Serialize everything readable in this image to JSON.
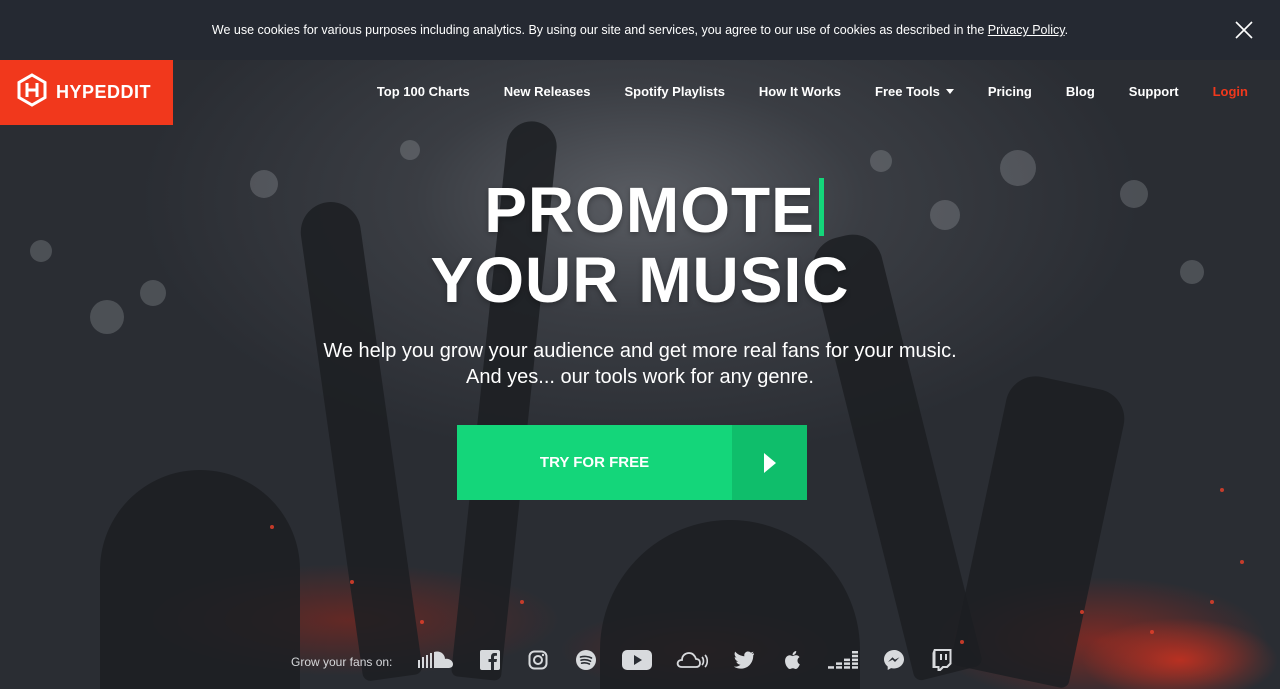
{
  "cookie_bar": {
    "text": "We use cookies for various purposes including analytics. By using our site and services, you agree to our use of cookies as described in the ",
    "link": "Privacy Policy",
    "end": ".",
    "close_icon": "close-icon"
  },
  "brand": {
    "name": "HYPEDDIT",
    "color": "#f1381c"
  },
  "nav": {
    "items": [
      "Top 100 Charts",
      "New Releases",
      "Spotify Playlists",
      "How It Works",
      "Free Tools",
      "Pricing",
      "Blog",
      "Support"
    ],
    "login": "Login"
  },
  "hero": {
    "line1": "PROMOTE",
    "line2": "YOUR MUSIC",
    "sub1": "We help you grow your audience and get more real fans for your music.",
    "sub2": "And yes... our tools work for any genre.",
    "cta": "TRY FOR FREE",
    "accent": "#14d67a"
  },
  "footer": {
    "label": "Grow your fans on:",
    "platforms": [
      "soundcloud-icon",
      "facebook-icon",
      "instagram-icon",
      "spotify-icon",
      "youtube-icon",
      "mixcloud-icon",
      "twitter-icon",
      "apple-icon",
      "deezer-icon",
      "messenger-icon",
      "twitch-icon"
    ]
  }
}
